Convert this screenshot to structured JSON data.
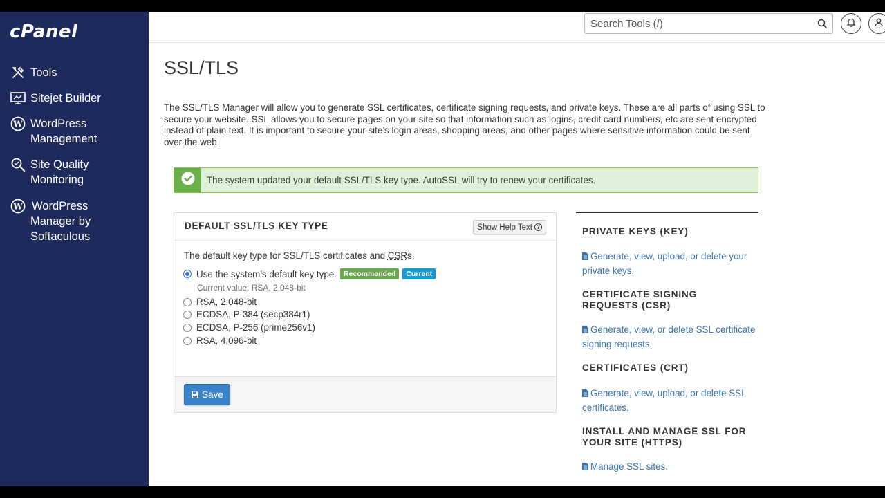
{
  "app": {
    "logo": "cPanel"
  },
  "sidebar": {
    "items": [
      {
        "label": "Tools",
        "icon": "tools-icon"
      },
      {
        "label": "Sitejet Builder",
        "icon": "sitejet-icon"
      },
      {
        "label": "WordPress Management",
        "icon": "wordpress-icon"
      },
      {
        "label": "Site Quality Monitoring",
        "icon": "site-quality-icon"
      },
      {
        "label": "WordPress Manager by Softaculous",
        "icon": "wordpress-icon"
      }
    ]
  },
  "header": {
    "search_placeholder": "Search Tools (/)",
    "icons": [
      "search-icon",
      "bell-icon",
      "user-icon"
    ]
  },
  "page": {
    "title": "SSL/TLS",
    "intro": "The SSL/TLS Manager will allow you to generate SSL certificates, certificate signing requests, and private keys. These are all parts of using SSL to secure your website. SSL allows you to secure pages on your site so that information such as logins, credit card numbers, etc are sent encrypted instead of plain text. It is important to secure your site’s login areas, shopping areas, and other pages where sensitive information could be sent over the web."
  },
  "alert": {
    "text": "The system updated your default SSL/TLS key type. AutoSSL will try to renew your certificates.",
    "color": "#6bb04a"
  },
  "panel": {
    "title": "DEFAULT SSL/TLS KEY TYPE",
    "help_label": "Show Help Text",
    "description_prefix": "The default key type for SSL/TLS certificates and ",
    "description_abbr": "CSR",
    "description_suffix": "s.",
    "options": [
      {
        "label": "Use the system’s default key type.",
        "checked": true
      },
      {
        "label": "RSA, 2,048-bit",
        "checked": false
      },
      {
        "label": "ECDSA, P-384 (secp384r1)",
        "checked": false
      },
      {
        "label": "ECDSA, P-256 (prime256v1)",
        "checked": false
      },
      {
        "label": "RSA, 4,096-bit",
        "checked": false
      }
    ],
    "badges": {
      "recommended": "Recommended",
      "current": "Current"
    },
    "current_value": "Current value: RSA, 2,048-bit",
    "save_label": "Save"
  },
  "right": {
    "sections": [
      {
        "heading": "PRIVATE KEYS (KEY)",
        "link": "Generate, view, upload, or delete your private keys."
      },
      {
        "heading": "CERTIFICATE SIGNING REQUESTS (CSR)",
        "link": "Generate, view, or delete SSL certificate signing requests."
      },
      {
        "heading": "CERTIFICATES (CRT)",
        "link": "Generate, view, upload, or delete SSL certificates."
      },
      {
        "heading": "INSTALL AND MANAGE SSL FOR YOUR SITE (HTTPS)",
        "link": "Manage SSL sites."
      }
    ]
  },
  "colors": {
    "sidebar_bg": "#1d2a5b",
    "link": "#3a73b0",
    "primary_button": "#3a83c9",
    "badge_recommended": "#6aa84f",
    "badge_current": "#179bd7"
  }
}
